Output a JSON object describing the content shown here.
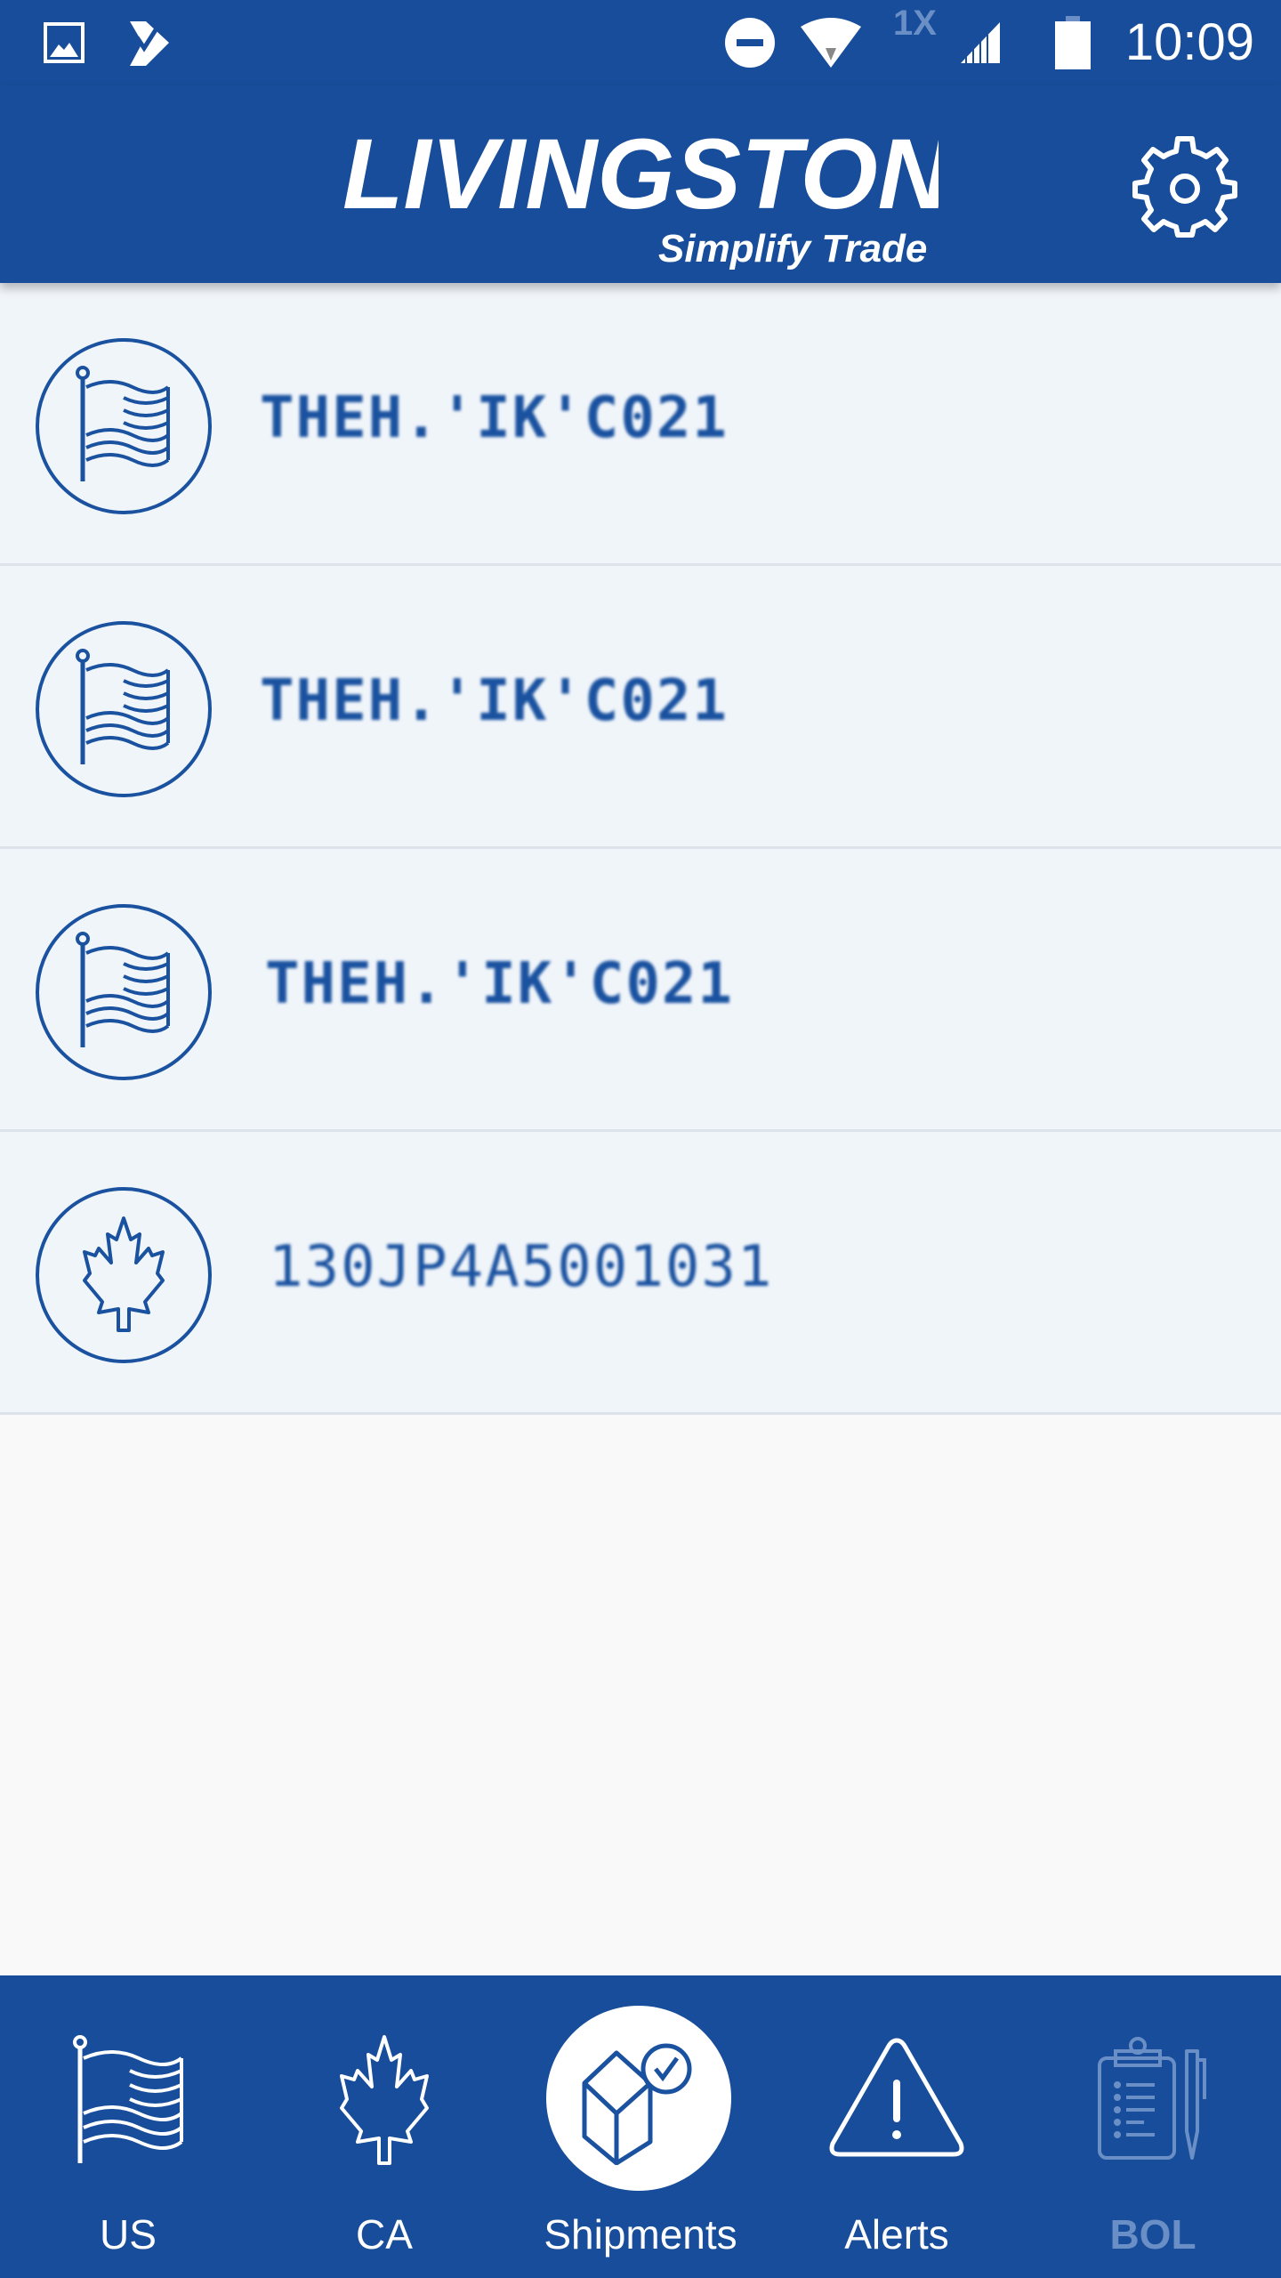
{
  "status_bar": {
    "left_icons": [
      "image-icon",
      "task-check-icon"
    ],
    "right_icons": [
      "do-not-disturb-icon",
      "wifi-icon",
      "roaming-1x-icon",
      "cell-signal-icon",
      "battery-icon"
    ],
    "roaming_label": "1X",
    "time": "10:09"
  },
  "app_bar": {
    "brand": "LIVINGSTON",
    "tagline": "Simplify Trade",
    "settings_icon": "gear-icon"
  },
  "shipments": [
    {
      "country": "US",
      "icon": "us-flag-icon",
      "id": "THEH.'IK'C021"
    },
    {
      "country": "US",
      "icon": "us-flag-icon",
      "id": "THEH.'IK'C021"
    },
    {
      "country": "US",
      "icon": "us-flag-icon",
      "id": "THEH.'IK'C021"
    },
    {
      "country": "CA",
      "icon": "maple-leaf-icon",
      "id": "130JP4A5001031"
    }
  ],
  "bottom_nav": {
    "items": [
      {
        "label": "US",
        "icon": "us-flag-icon",
        "active": false,
        "disabled": false
      },
      {
        "label": "CA",
        "icon": "maple-leaf-icon",
        "active": false,
        "disabled": false
      },
      {
        "label": "Shipments",
        "icon": "box-check-icon",
        "active": true,
        "disabled": false
      },
      {
        "label": "Alerts",
        "icon": "warning-triangle-icon",
        "active": false,
        "disabled": false
      },
      {
        "label": "BOL",
        "icon": "clipboard-pen-icon",
        "active": false,
        "disabled": true
      }
    ]
  },
  "colors": {
    "brand_blue": "#174d9a",
    "row_background": "#f0f5fa",
    "icon_blue": "#1a52a0",
    "disabled_nav": "#6a8fc6"
  }
}
